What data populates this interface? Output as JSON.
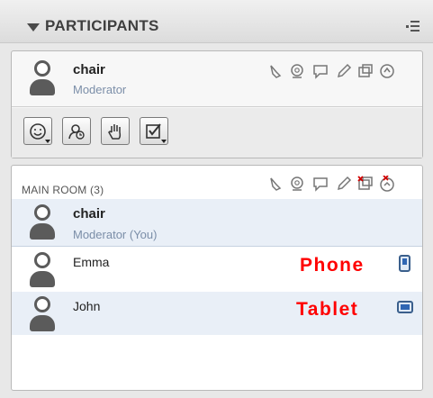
{
  "header": {
    "title": "PARTICIPANTS"
  },
  "me": {
    "name": "chair",
    "role": "Moderator",
    "status_icons": [
      "raise-hand-icon",
      "webcam-icon",
      "chat-icon",
      "pencil-icon",
      "share-icon",
      "audio-icon"
    ],
    "toolbar": [
      "set-status-button",
      "change-role-button",
      "raise-hand-button",
      "task-button"
    ]
  },
  "room": {
    "title": "MAIN ROOM (3)",
    "participants": [
      {
        "name": "chair",
        "role": "Moderator (You)"
      },
      {
        "name": "Emma",
        "device_label": "Phone",
        "device": "phone-icon"
      },
      {
        "name": "John",
        "device_label": "Tablet",
        "device": "tablet-icon"
      }
    ]
  },
  "colors": {
    "accent": "#7b8ea8",
    "highlight": "#ff0000",
    "row_selected": "#e9eff7"
  }
}
